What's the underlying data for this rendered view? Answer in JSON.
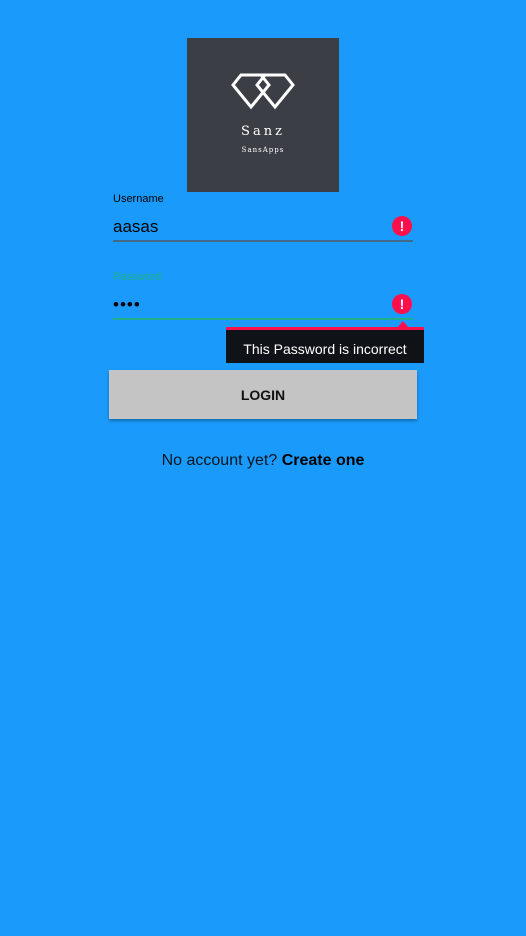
{
  "logo": {
    "name": "Sanz",
    "tagline": "SansApps",
    "icon": "diamond-logo-icon",
    "background_color": "#3b3e45"
  },
  "username": {
    "label": "Username",
    "value": "aasas",
    "error_icon": "error-icon"
  },
  "password": {
    "label": "Password",
    "value": "••••",
    "error_icon": "error-icon",
    "error_message": "This Password is incorrect"
  },
  "login_button": {
    "label": "LOGIN"
  },
  "signup": {
    "prompt": "No account yet?",
    "link": "Create one"
  },
  "colors": {
    "background": "#1a9bfc",
    "accent": "#1fb08a",
    "error": "#ff0f4c",
    "button": "#c4c4c4"
  }
}
